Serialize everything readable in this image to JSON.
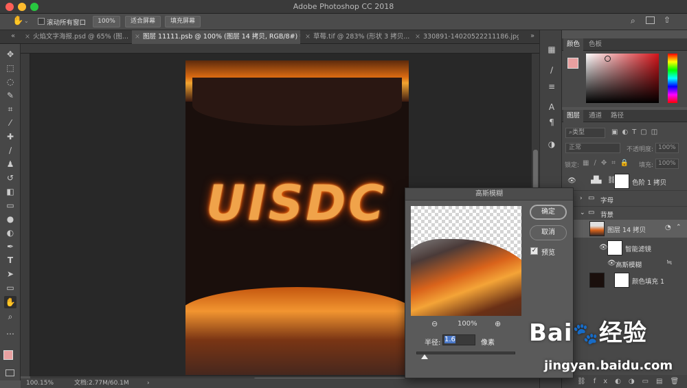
{
  "app": {
    "title": "Adobe Photoshop CC 2018"
  },
  "options_bar": {
    "scroll_all_label": "滚动所有窗口",
    "zoom_value": "100%",
    "fit_screen_label": "适合屏幕",
    "fill_screen_label": "填充屏幕"
  },
  "doc_tabs": [
    {
      "label": "火焰文字海报.psd @ 65% (图..."
    },
    {
      "label": "图层 11111.psb @ 100% (图层 14 拷贝, RGB/8#) *"
    },
    {
      "label": "草莓.tif @ 283% (形状 3 拷贝..."
    },
    {
      "label": "330891-14020522211186.jpg"
    }
  ],
  "tab_overflow": "»",
  "status": {
    "zoom": "100.15%",
    "doc_info": "文档:2.77M/60.1M",
    "arrow": "›"
  },
  "artwork": {
    "text": "UISDC"
  },
  "color_panel": {
    "tabs": [
      "颜色",
      "色板"
    ],
    "fg_color": "#e8a0a0",
    "hue_color": "#d4141a"
  },
  "layers_panel": {
    "tabs": [
      "图层",
      "通道",
      "路径"
    ],
    "filter_label": "类型",
    "blend_mode": "正常",
    "opacity_label": "不透明度:",
    "opacity_value": "100%",
    "lock_label": "锁定:",
    "fill_label": "填充:",
    "fill_value": "100%",
    "layers": [
      {
        "name": "色阶 1 拷贝"
      },
      {
        "name": "字母"
      },
      {
        "name": "背景"
      },
      {
        "name": "图层 14 拷贝"
      },
      {
        "name": "智能滤镜"
      },
      {
        "name": "高斯模糊"
      },
      {
        "name": "颜色填充 1"
      }
    ]
  },
  "dialog": {
    "title": "高斯模糊",
    "ok_label": "确定",
    "cancel_label": "取消",
    "preview_label": "预览",
    "preview_checked": true,
    "zoom_value": "100%",
    "radius_label": "半径:",
    "radius_value": "1.6",
    "unit_label": "像素",
    "radius_slider": 0.016
  },
  "watermark": {
    "brand": "Bai",
    "brand_cn": "经验",
    "url": "jingyan.baidu.com"
  }
}
